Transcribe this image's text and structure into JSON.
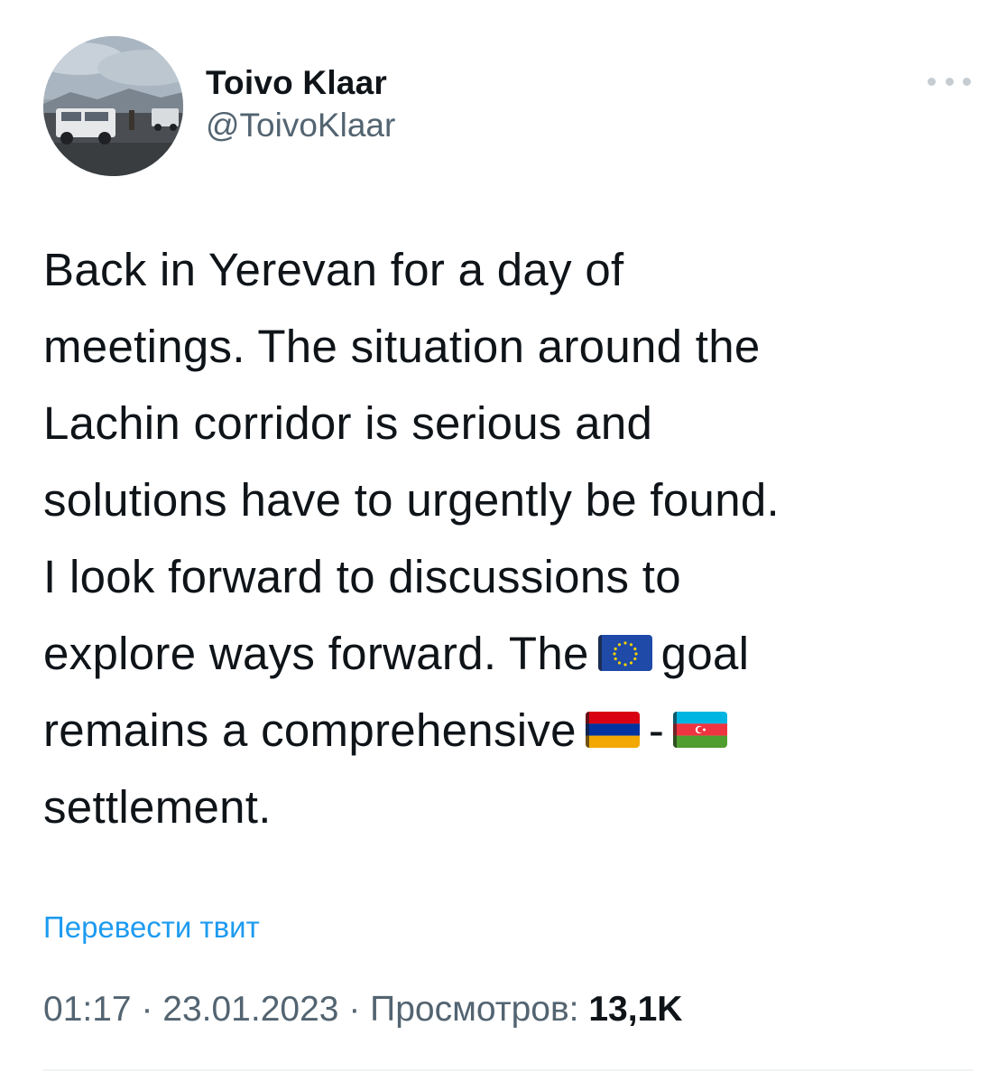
{
  "author": {
    "display_name": "Toivo Klaar",
    "handle": "@ToivoKlaar"
  },
  "more_button": {
    "icon": "more-horizontal-icon"
  },
  "tweet": {
    "lines": [
      "Back in Yerevan for a day of",
      "meetings. The situation around the",
      "Lachin corridor is serious and",
      "solutions have to urgently be found.",
      "I look forward to discussions to",
      "explore ways forward. The",
      "goal",
      "remains a comprehensive",
      "-",
      "settlement."
    ],
    "emojis": [
      "eu-flag-icon",
      "armenia-flag-icon",
      "azerbaijan-flag-icon"
    ]
  },
  "translate_link": "Перевести твит",
  "meta": {
    "time": "01:17",
    "separator": " · ",
    "date": "23.01.2023",
    "views_label": "Просмотров:",
    "views_count": "13,1K"
  },
  "colors": {
    "link": "#1d9bf0",
    "secondary_text": "#536471",
    "primary_text": "#0f1419"
  }
}
